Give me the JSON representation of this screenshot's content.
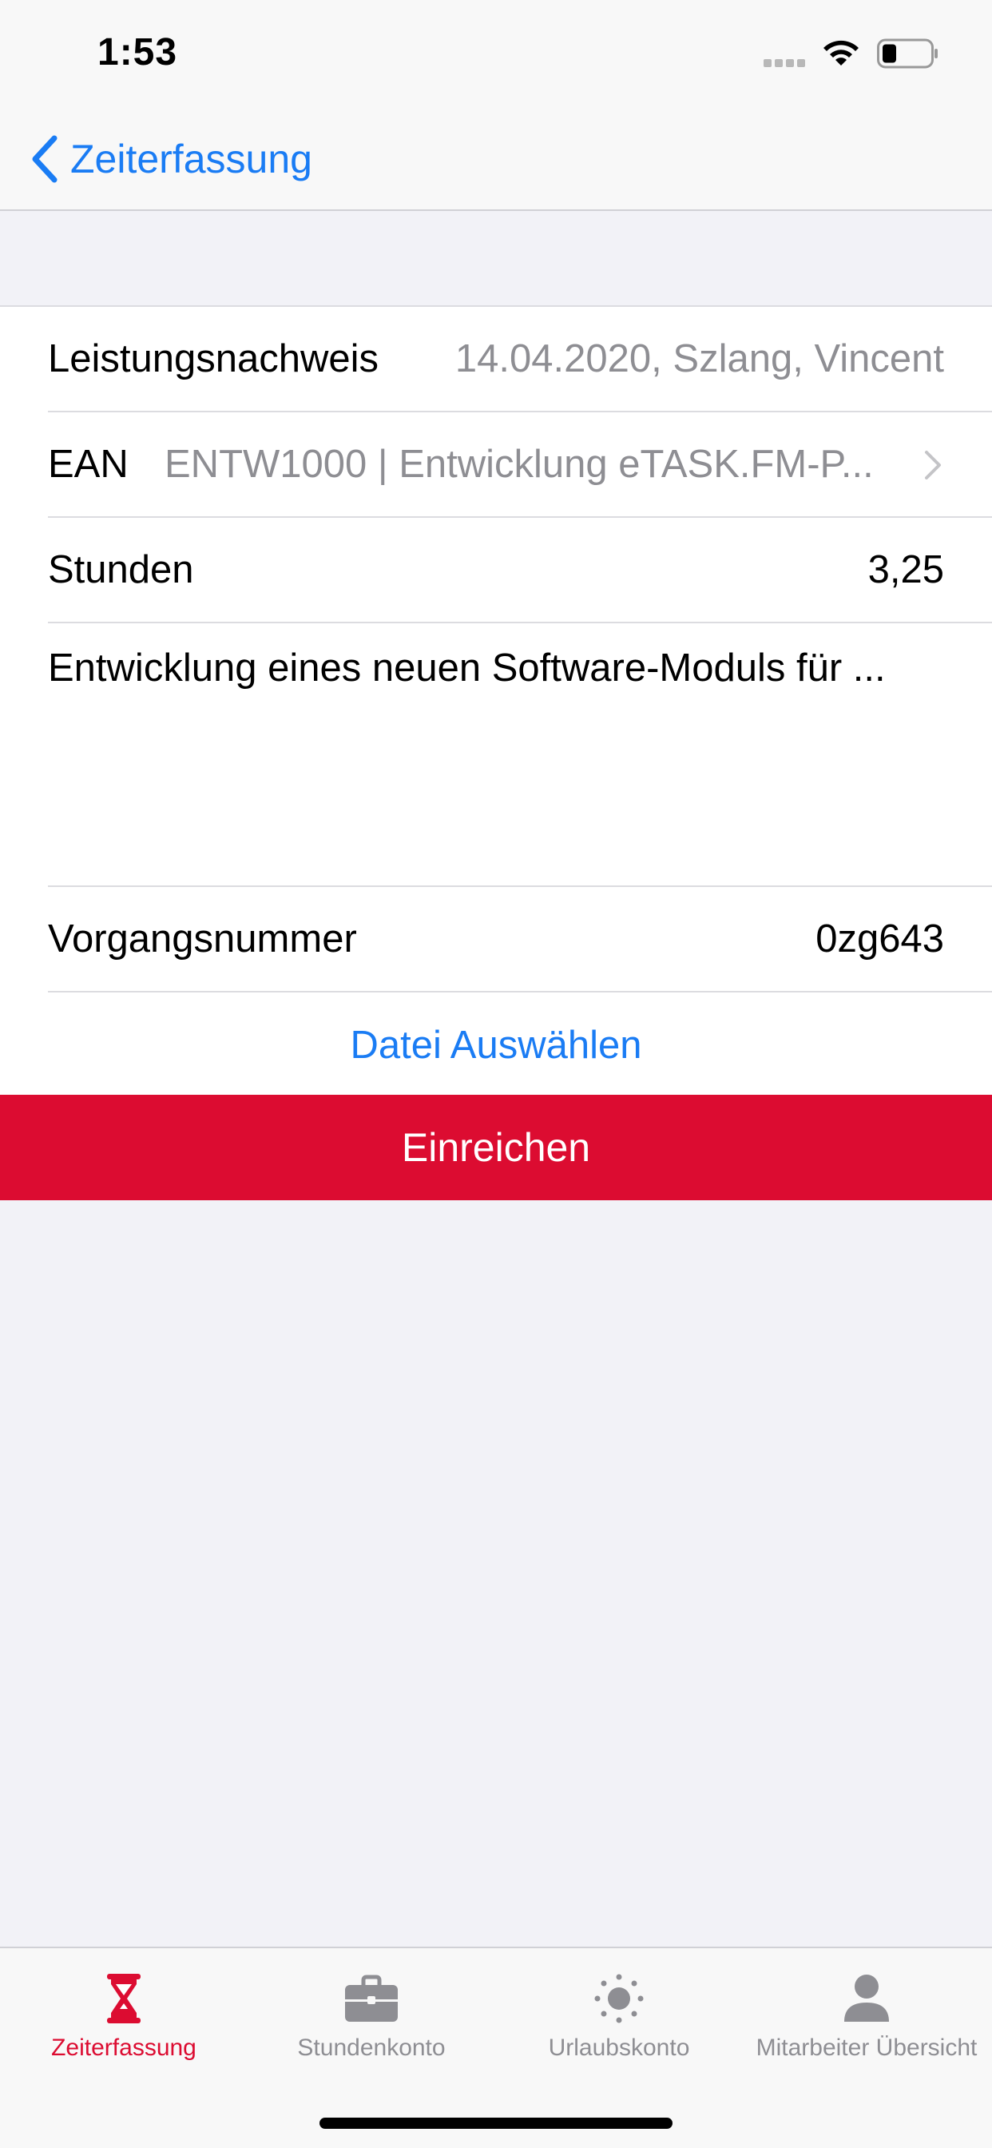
{
  "status_bar": {
    "time": "1:53"
  },
  "nav": {
    "back_label": "Zeiterfassung"
  },
  "form": {
    "leistungsnachweis": {
      "label": "Leistungsnachweis",
      "value": "14.04.2020, Szlang, Vincent"
    },
    "ean": {
      "label": "EAN",
      "value": "ENTW1000 | Entwicklung eTASK.FM-P..."
    },
    "stunden": {
      "label": "Stunden",
      "value": "3,25"
    },
    "description": "Entwicklung eines neuen Software-Moduls für ...",
    "vorgangsnummer": {
      "label": "Vorgangsnummer",
      "value": "0zg643"
    },
    "file_button": "Datei Auswählen",
    "submit_button": "Einreichen"
  },
  "tab_bar": {
    "tabs": [
      {
        "label": "Zeiterfassung",
        "icon": "hourglass-icon",
        "active": true
      },
      {
        "label": "Stundenkonto",
        "icon": "briefcase-icon",
        "active": false
      },
      {
        "label": "Urlaubskonto",
        "icon": "sun-icon",
        "active": false
      },
      {
        "label": "Mitarbeiter Übersicht",
        "icon": "person-icon",
        "active": false
      }
    ]
  },
  "colors": {
    "accent_blue": "#1a7cf4",
    "brand_red": "#dc0c31",
    "secondary_gray": "#8e8e93"
  }
}
